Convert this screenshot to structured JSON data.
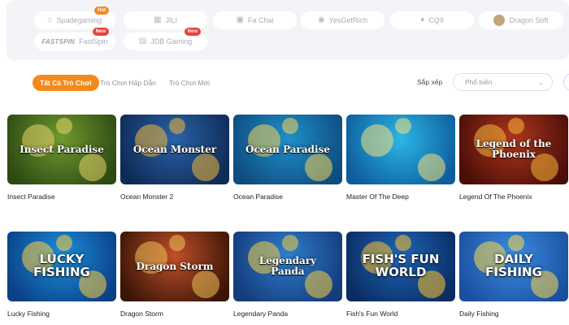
{
  "providers": [
    {
      "name": "Spadegaming",
      "icon": "spade-icon",
      "glyph": "⌂",
      "badge": "Hot"
    },
    {
      "name": "JILI",
      "icon": "jili-icon",
      "glyph": "▦",
      "badge": ""
    },
    {
      "name": "Fa Chai",
      "icon": "fachai-icon",
      "glyph": "▣",
      "badge": ""
    },
    {
      "name": "YesGetRich",
      "icon": "yesgetrich-icon",
      "glyph": "◉",
      "badge": ""
    },
    {
      "name": "CQ9",
      "icon": "cq9-icon",
      "glyph": "♦",
      "badge": ""
    },
    {
      "name": "Dragon Soft",
      "icon": "dragon-icon",
      "glyph": "",
      "badge": ""
    },
    {
      "name": "FastSpin",
      "brand": "FASTSPIN",
      "icon": "fastspin-icon",
      "glyph": "",
      "badge": "New"
    },
    {
      "name": "JDB Gaming",
      "icon": "jdb-icon",
      "glyph": "▤",
      "badge": "New"
    }
  ],
  "tabs": [
    "Tất Cả Trò Chơi",
    "Trò Chơi Hấp Dẫn",
    "Trò Chơi Mới"
  ],
  "sort": {
    "label": "Sắp xếp",
    "value": "Phổ biến"
  },
  "games": [
    {
      "name": "Insect Paradise",
      "title": "Insect Paradise",
      "style": "serif",
      "colors": [
        "#6f9a2f",
        "#2d4a12",
        "#e7d36a"
      ]
    },
    {
      "name": "Ocean Monster 2",
      "title": "Ocean Monster",
      "style": "serif",
      "colors": [
        "#2a63a8",
        "#0f2a55",
        "#f1b83a"
      ]
    },
    {
      "name": "Ocean Paradise",
      "title": "Ocean Paradise",
      "style": "serif",
      "colors": [
        "#1f8fc9",
        "#0e4c7e",
        "#f5d55a"
      ]
    },
    {
      "name": "Master Of The Deep",
      "title": "",
      "style": "serif",
      "colors": [
        "#2cb6e6",
        "#0d5d9c",
        "#f4e27b"
      ]
    },
    {
      "name": "Legend Of The Phoenix",
      "title": "Legend of the Phoenix",
      "style": "serif",
      "colors": [
        "#b0361c",
        "#4a0e08",
        "#f7b63c"
      ]
    },
    {
      "name": "Lucky Fishing",
      "title": "Lucky Fishing",
      "style": "big",
      "colors": [
        "#1c8fdc",
        "#0b3f86",
        "#ffd23f"
      ]
    },
    {
      "name": "Dragon Storm",
      "title": "Dragon Storm",
      "style": "serif",
      "colors": [
        "#c0502a",
        "#3a1506",
        "#f0c15a"
      ]
    },
    {
      "name": "Legendary Panda",
      "title": "Legendary Panda",
      "style": "serif",
      "colors": [
        "#2f7fcf",
        "#143b7a",
        "#f5d042"
      ]
    },
    {
      "name": "Fish's Fun World",
      "title": "Fish's Fun World",
      "style": "big",
      "colors": [
        "#1e66b8",
        "#0a2c62",
        "#ffc52e"
      ]
    },
    {
      "name": "Daily Fishing",
      "title": "Daily Fishing",
      "style": "big",
      "colors": [
        "#3c8ee0",
        "#1a4fa0",
        "#ffd84a"
      ]
    }
  ]
}
